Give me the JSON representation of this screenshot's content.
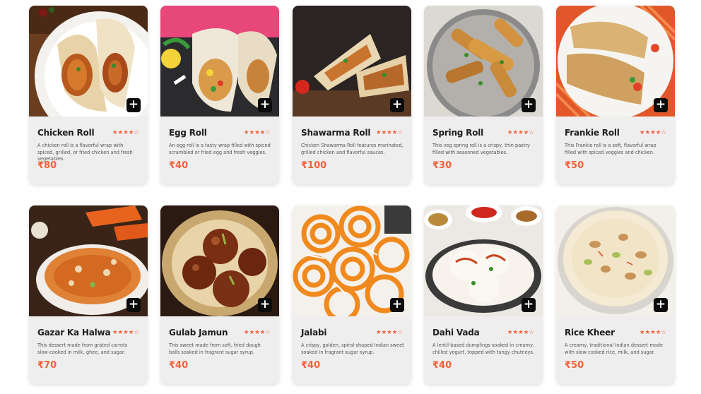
{
  "accent_color": "#f2603a",
  "add_icon": "plus-icon",
  "items": [
    {
      "name": "Chicken Roll",
      "rating": 4,
      "max_rating": 5,
      "description": "A chicken roll is a flavorful wrap with spiced, grilled, or fried chicken and fresh vegetables.",
      "price": "₹80",
      "image": "chicken-roll-photo"
    },
    {
      "name": "Egg Roll",
      "rating": 4,
      "max_rating": 5,
      "description": "An egg roll is a tasty wrap filled with spiced scrambled or fried egg and fresh veggies.",
      "price": "₹40",
      "image": "egg-roll-photo"
    },
    {
      "name": "Shawarma Roll",
      "rating": 4,
      "max_rating": 5,
      "description": "Chicken Shawarma Roll features marinated, grilled chicken and flavorful sauces.",
      "price": "₹100",
      "image": "shawarma-roll-photo"
    },
    {
      "name": "Spring Roll",
      "rating": 4,
      "max_rating": 5,
      "description": "This veg spring roll is a crispy, thin pastry filled with seasoned vegetables.",
      "price": "₹30",
      "image": "spring-roll-photo"
    },
    {
      "name": "Frankie Roll",
      "rating": 4,
      "max_rating": 5,
      "description": "This Frankie roll is a soft, flavorful wrap filled with spiced veggies and chicken.",
      "price": "₹50",
      "image": "frankie-roll-photo"
    },
    {
      "name": "Gazar Ka Halwa",
      "rating": 4,
      "max_rating": 5,
      "description": "This dessert made from grated carrots slow-cooked in milk, ghee, and sugar.",
      "price": "₹70",
      "image": "gazar-ka-halwa-photo"
    },
    {
      "name": "Gulab Jamun",
      "rating": 4,
      "max_rating": 5,
      "description": "This sweet made from soft, fried dough balls soaked in fragrant sugar syrup.",
      "price": "₹40",
      "image": "gulab-jamun-photo"
    },
    {
      "name": "Jalabi",
      "rating": 4,
      "max_rating": 5,
      "description": "A crispy, golden, spiral-shaped Indian sweet soaked in fragrant sugar syrup.",
      "price": "₹40",
      "image": "jalabi-photo"
    },
    {
      "name": "Dahi Vada",
      "rating": 4,
      "max_rating": 5,
      "description": "A lentil-based dumplings soaked in creamy, chilled yogurt, topped with tangy chutneys.",
      "price": "₹40",
      "image": "dahi-vada-photo"
    },
    {
      "name": "Rice Kheer",
      "rating": 4,
      "max_rating": 5,
      "description": "A creamy, traditional Indian dessert made with slow-cooked rice, milk, and sugar.",
      "price": "₹50",
      "image": "rice-kheer-photo"
    }
  ]
}
